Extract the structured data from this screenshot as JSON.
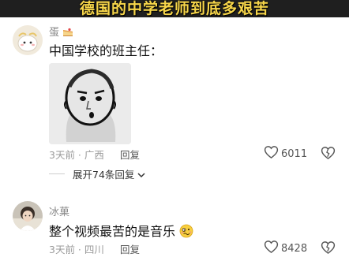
{
  "video": {
    "overlay_title": "德国的中学老师到底多艰苦"
  },
  "comments": [
    {
      "username": "蛋",
      "username_emoji": "cake-slice-emoji",
      "text": "中国学校的班主任：",
      "sticker": "meme-sticker-face",
      "time": "3天前",
      "location": "广西",
      "reply_label": "回复",
      "likes": "6011",
      "replies_expand": "展开74条回复"
    },
    {
      "username": "冰菓",
      "text": "整个视频最苦的是音乐",
      "text_emoji": "woozy-face-emoji",
      "time": "3天前",
      "location": "四川",
      "reply_label": "回复",
      "likes": "8428"
    }
  ],
  "icons": {
    "like": "heart-outline-icon",
    "dislike": "broken-heart-icon",
    "expand": "chevron-down-icon"
  },
  "colors": {
    "title_text": "#f7d64a",
    "title_bg": "#1f1f1f",
    "meta": "#9a9a9a"
  }
}
